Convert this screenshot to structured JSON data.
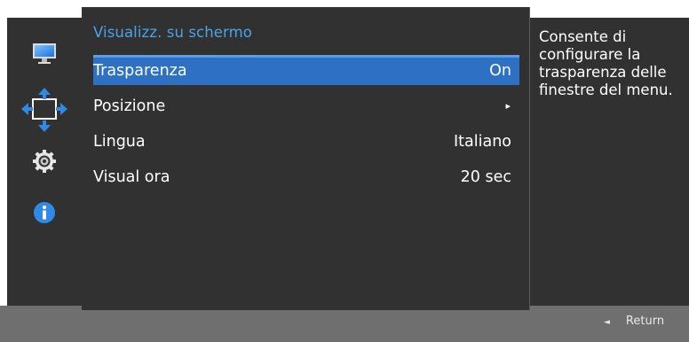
{
  "sidebar": {
    "icons": [
      {
        "name": "monitor-icon"
      },
      {
        "name": "position-arrows-icon"
      },
      {
        "name": "gear-icon"
      },
      {
        "name": "info-icon"
      }
    ]
  },
  "menu": {
    "title": "Visualizz. su schermo",
    "items": [
      {
        "label": "Trasparenza",
        "value": "On",
        "selected": true
      },
      {
        "label": "Posizione",
        "value": "▸",
        "selected": false
      },
      {
        "label": "Lingua",
        "value": "Italiano",
        "selected": false
      },
      {
        "label": "Visual ora",
        "value": "20 sec",
        "selected": false
      }
    ]
  },
  "info": {
    "text": "Consente di configurare la trasparenza delle finestre del menu."
  },
  "footer": {
    "return_arrow": "◄",
    "return_label": "Return"
  },
  "colors": {
    "panel_bg": "#313131",
    "selection": "#2d70c4",
    "title_accent": "#4aa3e8",
    "footer_bg": "#6f6f6f"
  }
}
